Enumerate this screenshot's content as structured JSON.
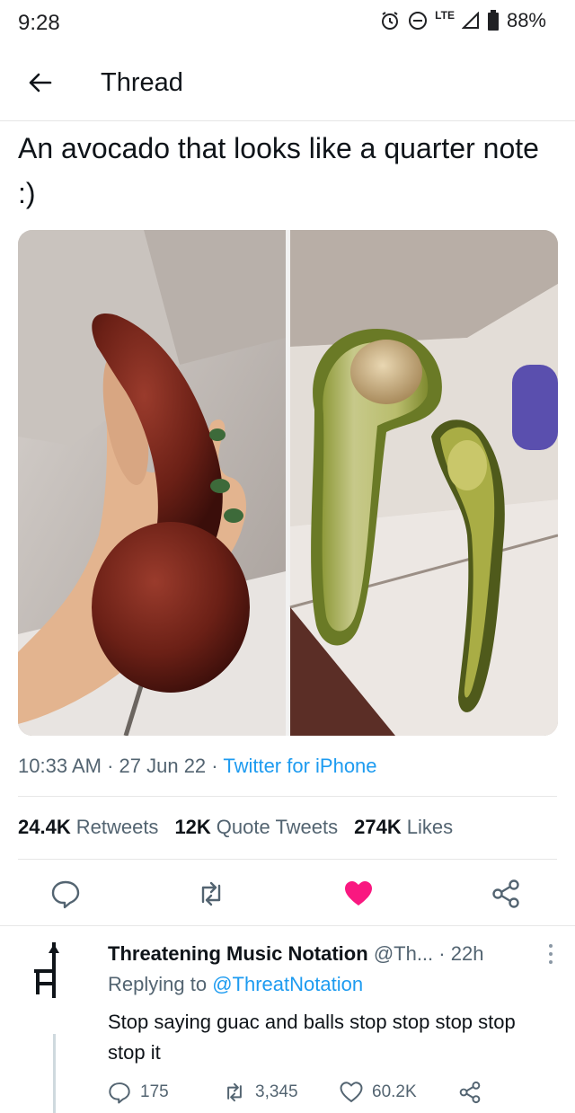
{
  "status_bar": {
    "time": "9:28",
    "network": "LTE",
    "battery": "88%"
  },
  "header": {
    "title": "Thread"
  },
  "tweet": {
    "text": "An avocado that looks like a quarter note :)",
    "time": "10:33 AM",
    "date": "27 Jun 22",
    "source": "Twitter for iPhone",
    "retweets_count": "24.4K",
    "retweets_label": "Retweets",
    "quotes_count": "12K",
    "quotes_label": "Quote Tweets",
    "likes_count": "274K",
    "likes_label": "Likes",
    "liked": true,
    "like_color": "#f91880"
  },
  "reply": {
    "name": "Threatening Music Notation",
    "handle": "@Th...",
    "age": "22h",
    "replying_prefix": "Replying to",
    "replying_to": "@ThreatNotation",
    "text": "Stop saying guac and balls stop stop stop stop stop it",
    "reply_count": "175",
    "retweet_count": "3,345",
    "like_count": "60.2K"
  },
  "colors": {
    "accent": "#1d9bf0",
    "secondary_text": "#536471",
    "primary_text": "#0f1419"
  }
}
